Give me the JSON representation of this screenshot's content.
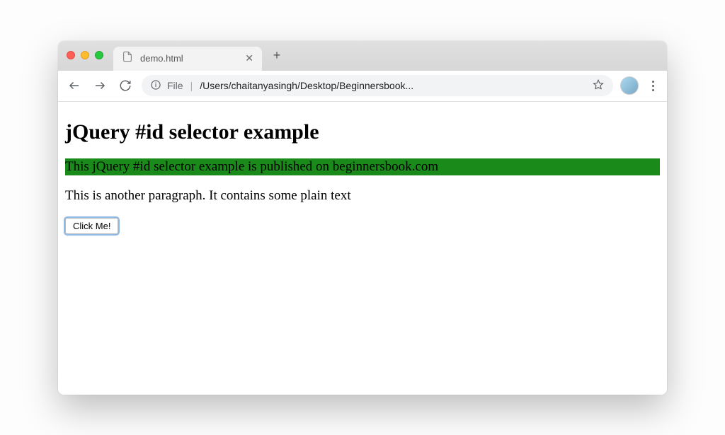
{
  "browser": {
    "tab": {
      "title": "demo.html"
    },
    "toolbar": {
      "url_scheme_label": "File",
      "url_path": "/Users/chaitanyasingh/Desktop/Beginnersbook..."
    }
  },
  "page": {
    "heading": "jQuery #id selector example",
    "highlighted_paragraph": "This jQuery #id selector example is published on beginnersbook.com",
    "plain_paragraph": "This is another paragraph. It contains some plain text",
    "button_label": "Click Me!"
  },
  "colors": {
    "highlight_bg": "#1a8a1a"
  }
}
